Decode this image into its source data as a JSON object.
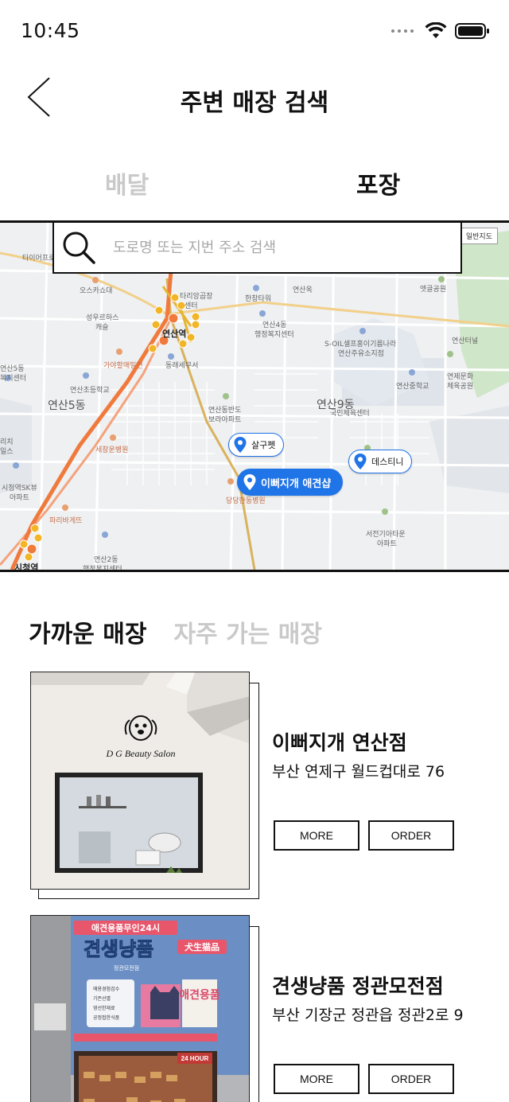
{
  "status_bar": {
    "time": "10:45"
  },
  "header": {
    "title": "주변 매장 검색"
  },
  "tabs": [
    {
      "label": "배달",
      "active": false
    },
    {
      "label": "포장",
      "active": true
    }
  ],
  "search": {
    "placeholder": "도로명 또는 지번 주소 검색"
  },
  "map": {
    "map_type_button": "일반지도",
    "labels": {
      "l1": "타이어프로",
      "l2": "오스카쇼대",
      "l3": "성우르하스",
      "l3b": "캐슬",
      "l4": "연산역",
      "l5": "가야할매밀면",
      "l6": "동래세무서",
      "l7": "타리앙곱창",
      "l7b": "센터",
      "l8": "한창타워",
      "l9": "연산4동",
      "l9b": "행정복지센터",
      "l10": "연산옥",
      "l11": "S-OIL셀프홍이기름나라",
      "l11b": "연산주유소지점",
      "l12": "엣골공원",
      "l13": "연산터널",
      "l14": "연산초등학교",
      "l15": "연산5동",
      "l16": "연산중학교",
      "l17": "연제문화",
      "l17b": "체육공원",
      "l18": "연산동반도",
      "l18b": "보라아파트",
      "l19": "연산9동",
      "l19b": "국민체육센터",
      "l20": "세창운병원",
      "l21": "시청역SK뷰",
      "l21b": "아파트",
      "l22": "파리바게뜨",
      "l23": "연산2동",
      "l23b": "행정복지센터",
      "l24": "시청역",
      "l25": "당당한동병원",
      "l26": "서전기아타운",
      "l26b": "아파트",
      "l27": "연산5동",
      "l27b": "복지센터",
      "l28": "리치",
      "l28b": "일스"
    },
    "pins": [
      {
        "label": "살구펫",
        "selected": false
      },
      {
        "label": "이뻐지개 애견샵",
        "selected": true
      },
      {
        "label": "데스티니",
        "selected": false
      }
    ]
  },
  "store_tabs": [
    {
      "label": "가까운 매장",
      "active": true
    },
    {
      "label": "자주 가는 매장",
      "active": false
    }
  ],
  "stores": [
    {
      "name": "이뻐지개 연산점",
      "address": "부산 연제구 월드컵대로 76",
      "more_label": "MORE",
      "order_label": "ORDER",
      "sign_text": "D G Beauty Salon"
    },
    {
      "name": "견생냥품 정관모전점",
      "address": "부산 기장군 정관읍 정관2로 9",
      "more_label": "MORE",
      "order_label": "ORDER",
      "sign_top": "애견용품무인24시",
      "sign_main": "견생냥품",
      "sign_cjk": "犬生猫品",
      "sign_sub": "정관모전점",
      "sign_side": "애견용품",
      "sign_list": [
        "애용경험검수",
        "기존선별",
        "영선한재료",
        "공정접한식품"
      ],
      "sign_hours": "24 HOUR"
    }
  ]
}
